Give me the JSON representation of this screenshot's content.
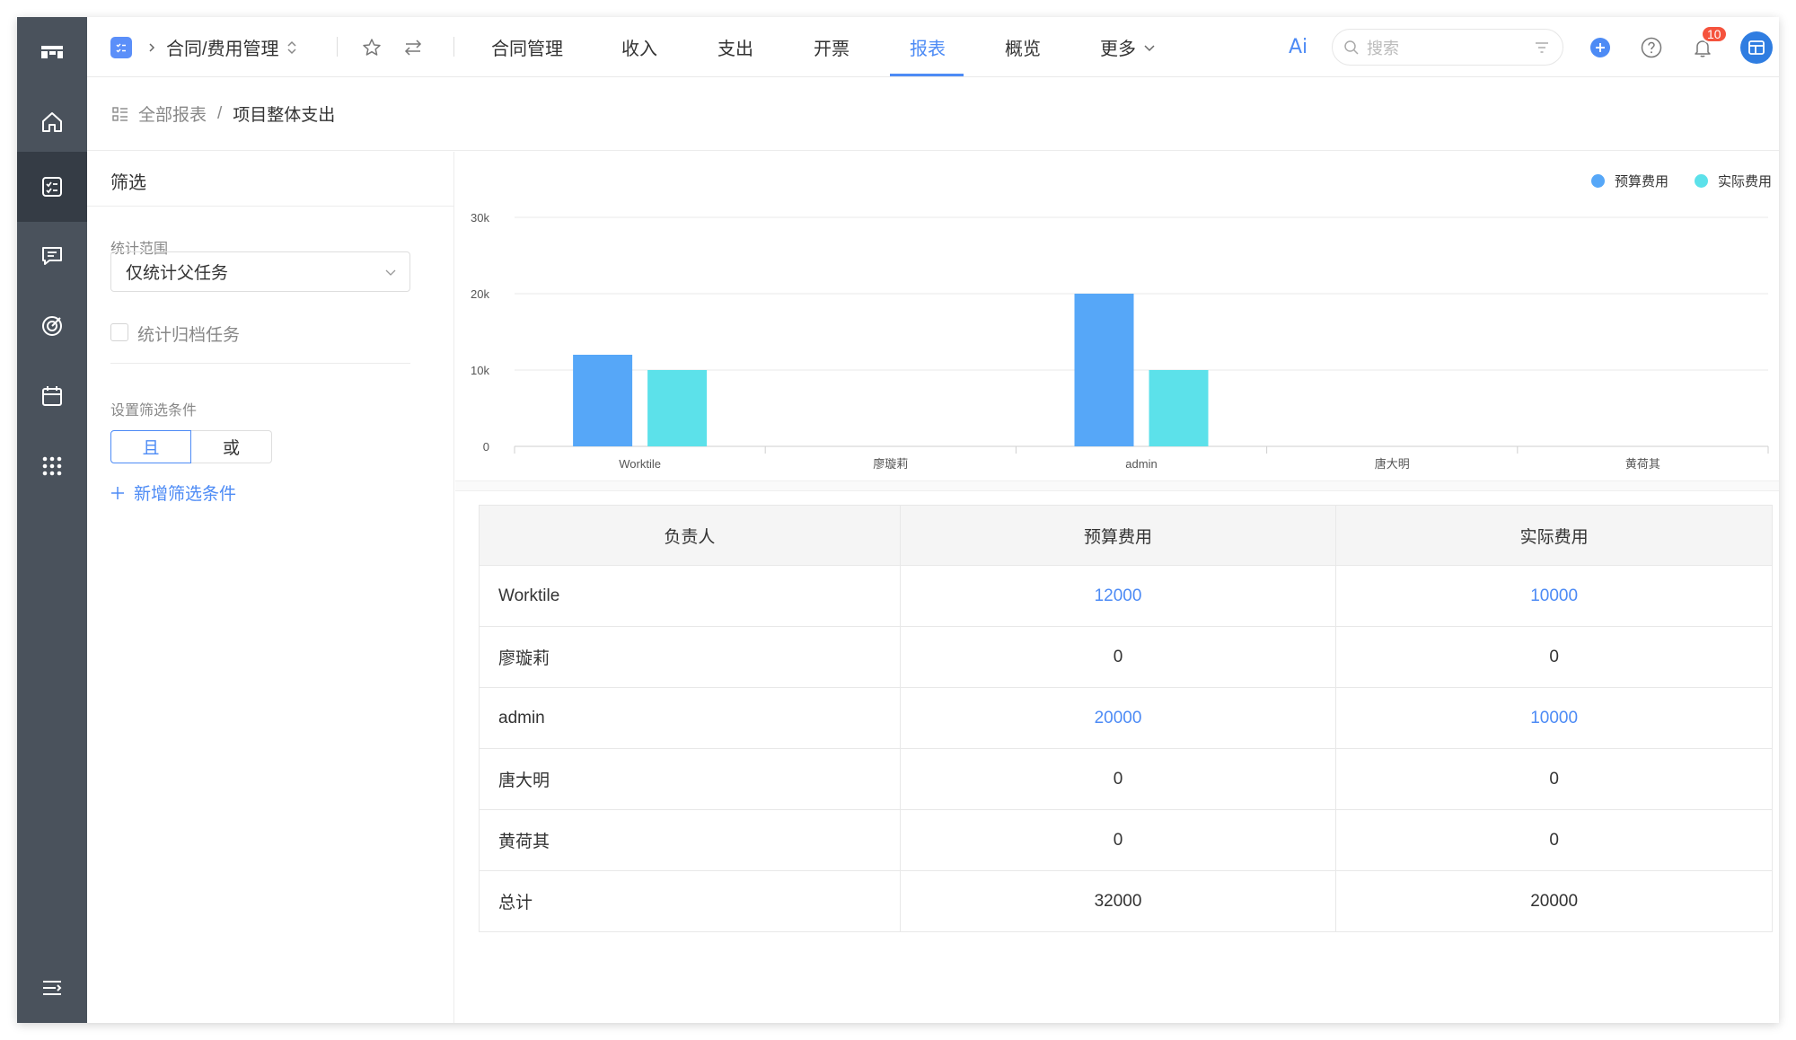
{
  "app": {
    "title": "合同/费用管理"
  },
  "nav": {
    "items": [
      {
        "label": "合同管理",
        "active": false
      },
      {
        "label": "收入",
        "active": false
      },
      {
        "label": "支出",
        "active": false
      },
      {
        "label": "开票",
        "active": false
      },
      {
        "label": "报表",
        "active": true
      },
      {
        "label": "概览",
        "active": false
      },
      {
        "label": "更多",
        "active": false
      }
    ],
    "ai_label": "Ai",
    "search_placeholder": "搜索",
    "notification_count": "10"
  },
  "breadcrumb": {
    "root": "全部报表",
    "separator": "/",
    "current": "项目整体支出"
  },
  "filter": {
    "title": "筛选",
    "scope_label": "统计范围",
    "scope_value": "仅统计父任务",
    "archived_label": "统计归档任务",
    "archived_checked": false,
    "conditions_label": "设置筛选条件",
    "and_label": "且",
    "or_label": "或",
    "add_condition_label": "新增筛选条件"
  },
  "colors": {
    "accent": "#4d8bf5",
    "budget": "#56a7f8",
    "actual": "#5ce1ea",
    "rail": "#4a525c",
    "badge": "#f5533d"
  },
  "chart_data": {
    "type": "bar",
    "categories": [
      "Worktile",
      "廖璇莉",
      "admin",
      "唐大明",
      "黄荷其"
    ],
    "series": [
      {
        "name": "预算费用",
        "values": [
          12000,
          0,
          20000,
          0,
          0
        ]
      },
      {
        "name": "实际费用",
        "values": [
          10000,
          0,
          10000,
          0,
          0
        ]
      }
    ],
    "yticks": [
      "0",
      "10k",
      "20k",
      "30k"
    ],
    "ylim": [
      0,
      30000
    ],
    "grid": true,
    "legend_position": "top-right"
  },
  "table": {
    "headers": [
      "负责人",
      "预算费用",
      "实际费用"
    ],
    "rows": [
      {
        "name": "Worktile",
        "budget": "12000",
        "actual": "10000"
      },
      {
        "name": "廖璇莉",
        "budget": "0",
        "actual": "0"
      },
      {
        "name": "admin",
        "budget": "20000",
        "actual": "10000"
      },
      {
        "name": "唐大明",
        "budget": "0",
        "actual": "0"
      },
      {
        "name": "黄荷其",
        "budget": "0",
        "actual": "0"
      }
    ],
    "total": {
      "name": "总计",
      "budget": "32000",
      "actual": "20000"
    }
  }
}
